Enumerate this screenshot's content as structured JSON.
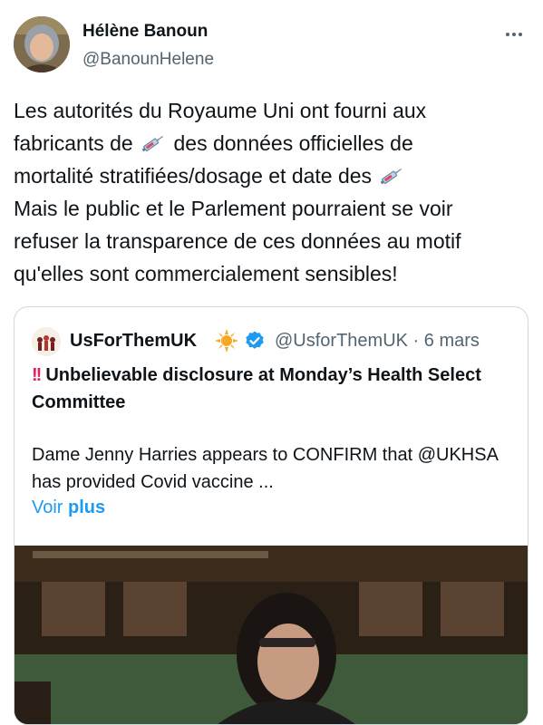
{
  "tweet": {
    "author_name": "Hélène Banoun",
    "author_handle": "@BanounHelene",
    "more_icon": "more-horizontal-icon",
    "text_lines": [
      {
        "before": "Les autorités du Royaume Uni ont fourni aux",
        "emoji": false,
        "after": ""
      },
      {
        "before": "fabricants de",
        "emoji": true,
        "after": "des données officielles de"
      },
      {
        "before": "mortalité stratifiées/dosage et date des",
        "emoji": true,
        "after": ""
      },
      {
        "before": "Mais le public et le Parlement pourraient se voir",
        "emoji": false,
        "after": ""
      },
      {
        "before": "refuser la transparence de ces données au motif",
        "emoji": false,
        "after": ""
      },
      {
        "before": "qu'elles sont commercialement sensibles!",
        "emoji": false,
        "after": ""
      }
    ]
  },
  "quote": {
    "author_name": "UsForThemUK",
    "author_handle_date": "@UsforThemUK · 6 mars",
    "title_bang": "!!",
    "title": "Unbelievable disclosure at Monday’s Health Select Committee",
    "body": "Dame Jenny Harries appears to CONFIRM that @UKHSA has provided Covid vaccine ...",
    "see_more_prefix": "Voir",
    "see_more_bold": "plus"
  },
  "colors": {
    "text": "#0f1419",
    "secondary": "#536471",
    "link": "#1d9bf0",
    "border": "#cfd9de"
  }
}
